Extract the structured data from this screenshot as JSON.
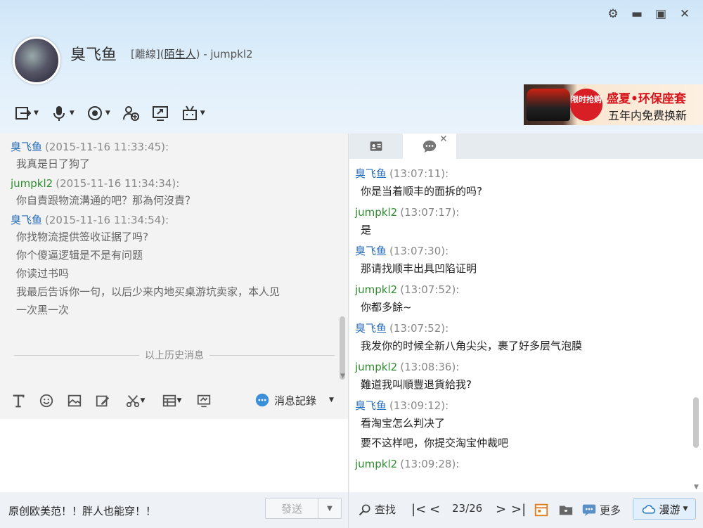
{
  "window": {
    "controls": [
      "gear-icon",
      "minimize-icon",
      "maximize-icon",
      "close-icon"
    ]
  },
  "contact": {
    "name": "臭飞鱼",
    "status": "[離線](",
    "relation": "陌生人",
    "account_suffix": ") - jumpkl2"
  },
  "ad": {
    "badge": "限时抢购",
    "line1": "盛夏•环保座套",
    "line2": "五年内免费换新"
  },
  "toolbar": {
    "items": [
      "transfer-file-icon",
      "voice-call-icon",
      "video-call-icon",
      "add-contact-icon",
      "share-screen-icon",
      "app-icon"
    ]
  },
  "left_history": {
    "messages": [
      {
        "sender": "臭飞鱼",
        "color": "blue",
        "time": "(2015-11-16 11:33:45):",
        "lines": [
          "我真是日了狗了"
        ]
      },
      {
        "sender": "jumpkl2",
        "color": "green",
        "time": "(2015-11-16 11:34:34):",
        "lines": [
          "你自責跟物流溝通的吧？那為何沒責？"
        ]
      },
      {
        "sender": "臭飞鱼",
        "color": "blue",
        "time": "(2015-11-16 11:34:54):",
        "lines": [
          "你找物流提供签收证据了吗?",
          "你个傻逼逻辑是不是有问题",
          "你读过书吗",
          "我最后告诉你一句，以后少来内地买桌游坑卖家，本人见",
          "一次黑一次"
        ]
      }
    ],
    "separator": "以上历史消息"
  },
  "input_toolbar": {
    "history_label": "消息記錄"
  },
  "signature": "原创欧美范！！胖人也能穿！！",
  "send": {
    "label": "發送"
  },
  "right_history": {
    "messages": [
      {
        "sender": "臭飞鱼",
        "color": "blue",
        "time": "(13:07:11):",
        "lines": [
          "你是当着顺丰的面拆的吗?"
        ]
      },
      {
        "sender": "jumpkl2",
        "color": "green",
        "time": "(13:07:17):",
        "lines": [
          "是"
        ]
      },
      {
        "sender": "臭飞鱼",
        "color": "blue",
        "time": "(13:07:30):",
        "lines": [
          "那请找顺丰出具凹陷证明"
        ]
      },
      {
        "sender": "jumpkl2",
        "color": "green",
        "time": "(13:07:52):",
        "lines": [
          "你都多餘~"
        ]
      },
      {
        "sender": "臭飞鱼",
        "color": "blue",
        "time": "(13:07:52):",
        "lines": [
          "我发你的时候全新八角尖尖，裹了好多层气泡膜"
        ]
      },
      {
        "sender": "jumpkl2",
        "color": "green",
        "time": "(13:08:36):",
        "lines": [
          "難道我叫順豐退貨給我?"
        ]
      },
      {
        "sender": "臭飞鱼",
        "color": "blue",
        "time": "(13:09:12):",
        "lines": [
          "看淘宝怎么判决了",
          "要不这样吧，你提交淘宝仲裁吧"
        ]
      },
      {
        "sender": "jumpkl2",
        "color": "green",
        "time": "(13:09:28):",
        "lines": [
          ""
        ]
      }
    ]
  },
  "bottom_right": {
    "search_label": "查找",
    "page": "23/26",
    "more_label": "更多",
    "roam_label": "漫游"
  }
}
